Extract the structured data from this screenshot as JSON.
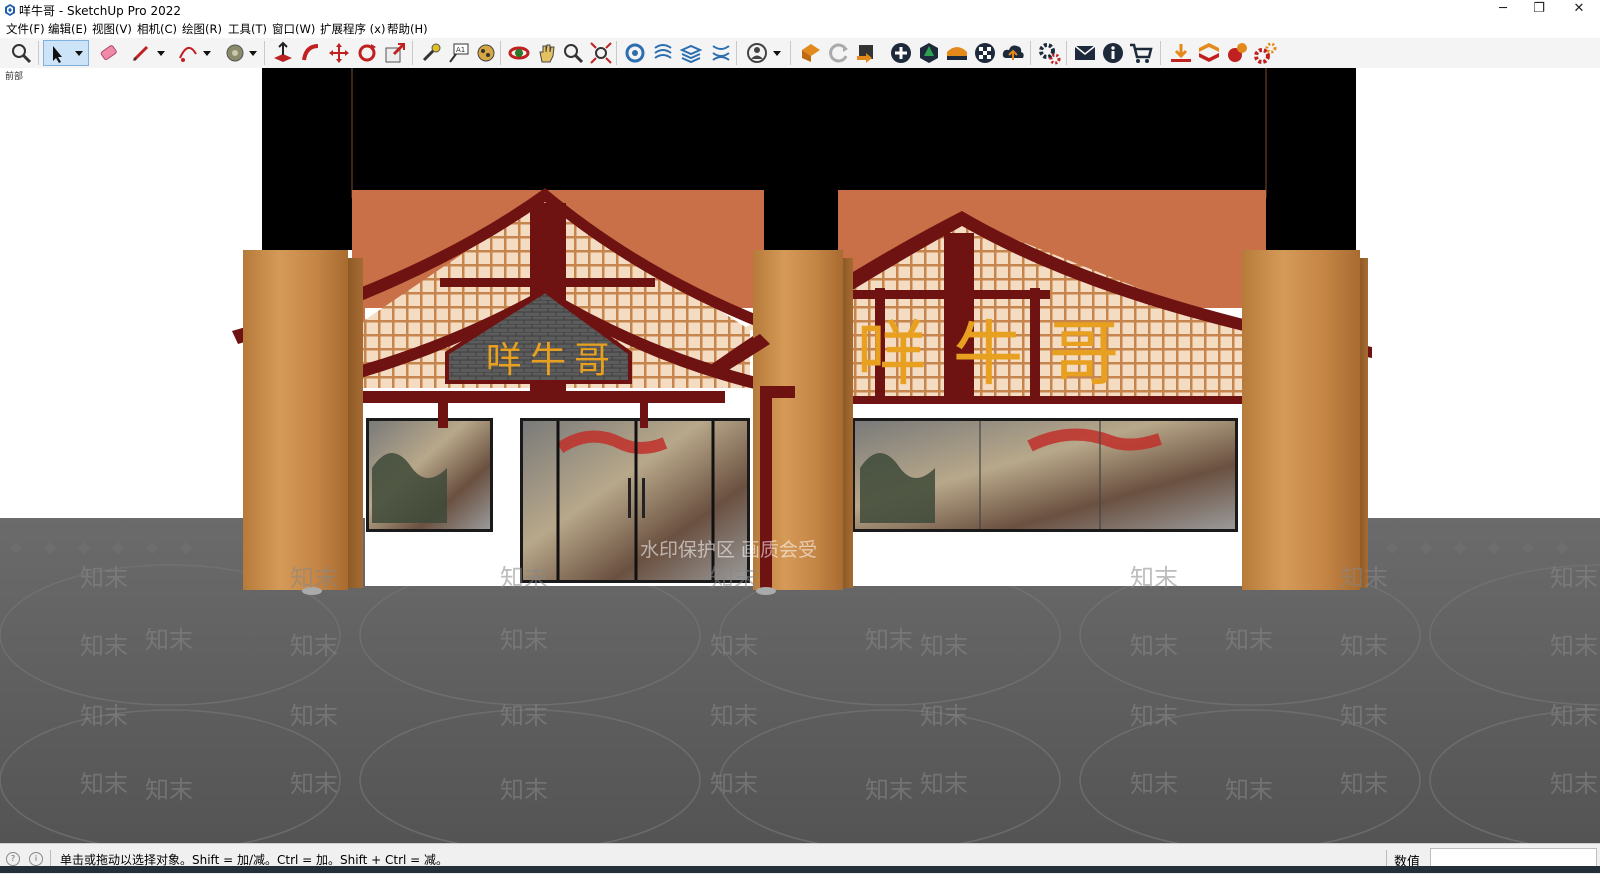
{
  "window": {
    "title": "咩牛哥 - SketchUp Pro 2022",
    "controls": [
      "─",
      "❐",
      "✕"
    ]
  },
  "menu": [
    "文件(F)",
    "编辑(E)",
    "视图(V)",
    "相机(C)",
    "绘图(R)",
    "工具(T)",
    "窗口(W)",
    "扩展程序 (x)",
    "帮助(H)"
  ],
  "toolbar": {
    "tools": [
      "zoom-icon",
      "select-icon",
      "eraser-icon",
      "pencil-icon",
      "arc-icon",
      "paint-bucket-icon",
      "push-pull-icon",
      "follow-me-icon",
      "move-icon",
      "rotate-icon",
      "scale-icon",
      "tape-measure-icon",
      "text-icon",
      "paint-icon",
      "orbit-icon",
      "pan-icon",
      "zoom-window-icon",
      "zoom-extents-icon",
      "components-icon",
      "materials-icon",
      "layers-icon",
      "styles-icon",
      "account-icon",
      "warehouse-icon",
      "refresh-icon",
      "extension-icon",
      "add-icon",
      "tree-icon",
      "gradient-icon",
      "checker-icon",
      "cloud-upload-icon",
      "settings-icon",
      "mail-icon",
      "info-icon",
      "cart-icon",
      "download-icon",
      "bookmark-icon",
      "plugin-icon",
      "gear-plugin-icon"
    ],
    "accent": "#2f7fd1"
  },
  "viewport": {
    "scene_label": "前部",
    "sign_text": "咩牛哥",
    "watermark_text": "知末",
    "watermark_banner": "水印保护区  画质会受",
    "colors": {
      "timber": "#6f1212",
      "wood_column": "#c48a47",
      "orange_wall": "#c97049",
      "lattice": "#e2b78a",
      "floor": "#5e5e5e",
      "sign_gold": "#e8a020"
    }
  },
  "status": {
    "text": "单击或拖动以选择对象。Shift = 加/减。Ctrl = 加。Shift + Ctrl = 减。",
    "measure_label": "数值",
    "measure_value": ""
  }
}
